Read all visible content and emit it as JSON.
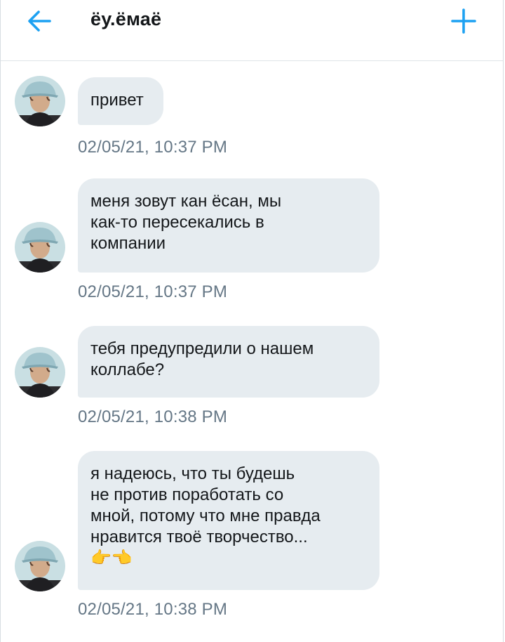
{
  "header": {
    "title": "ёу.ёмаё",
    "back_icon": "arrow-left-icon",
    "new_icon": "plus-icon",
    "accent_color": "#1da1f2"
  },
  "messages": [
    {
      "lines": [
        "привет"
      ],
      "time": "02/05/21, 10:37 PM"
    },
    {
      "lines": [
        "меня зовут кан ёсан, мы",
        "как-то пересекались в",
        "компании"
      ],
      "time": "02/05/21, 10:37 PM"
    },
    {
      "lines": [
        "тебя предупредили о нашем",
        "коллабе?"
      ],
      "time": "02/05/21, 10:38 PM"
    },
    {
      "lines": [
        "я надеюсь, что ты будешь",
        "не против поработать со",
        "мной, потому что мне правда",
        "нравится твоё творчество...",
        "👉👈"
      ],
      "time": "02/05/21, 10:38 PM"
    }
  ]
}
